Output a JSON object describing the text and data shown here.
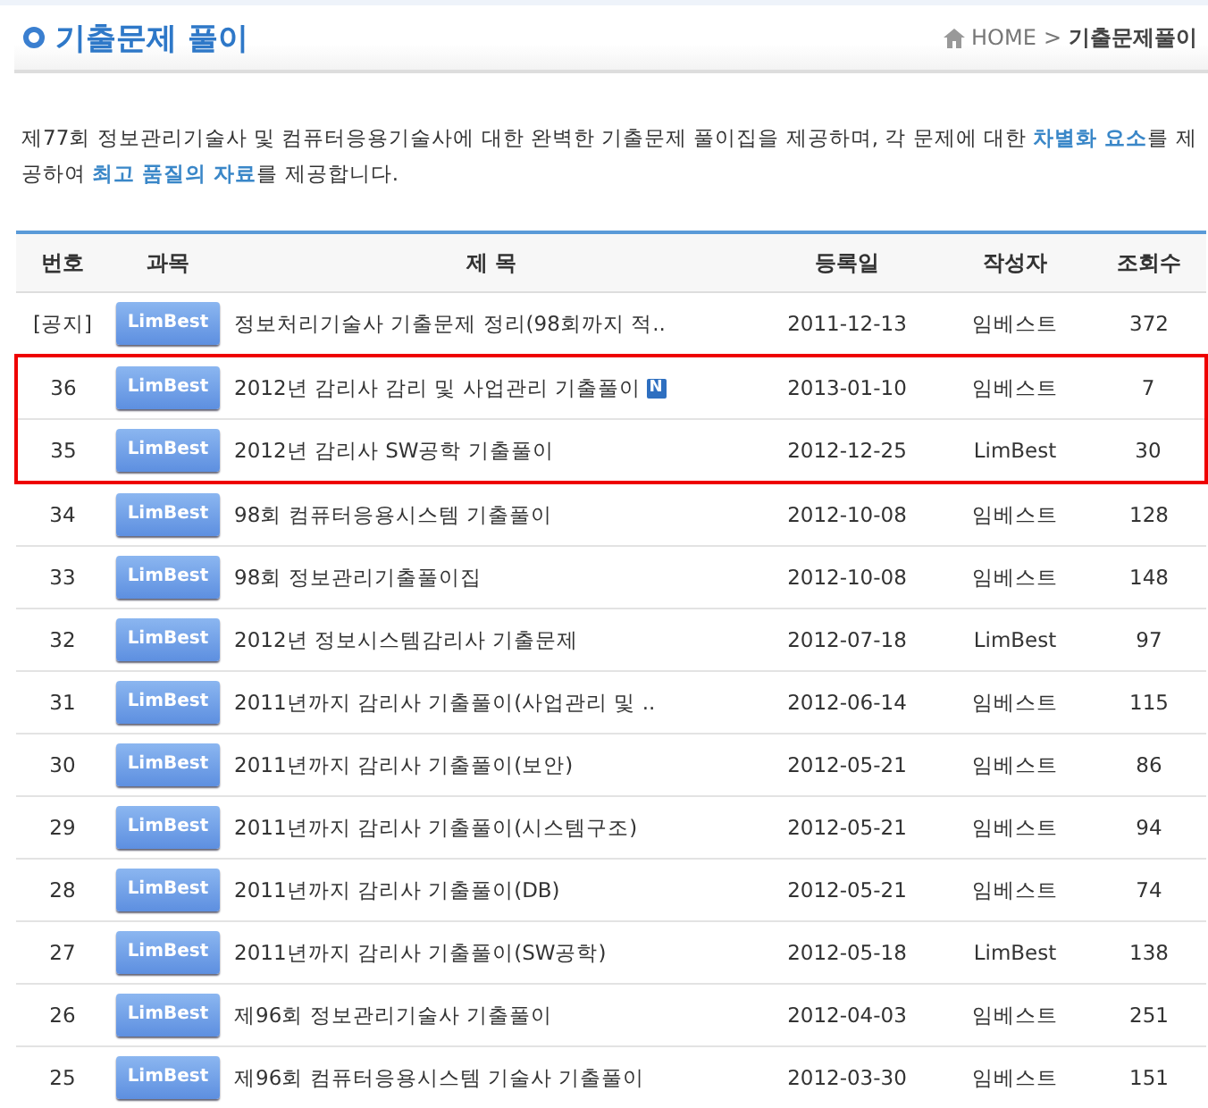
{
  "page_title": "기출문제 풀이",
  "breadcrumb": [
    "HOME",
    "기출문제풀이"
  ],
  "breadcrumb_separator": ">",
  "intro": "제77회 정보관리기술사 및 컴퓨터응용기술사에 대한 완벽한 기출문제 풀이집을 제공하며, 각 문제에 대한 **차별화 요소**를 제공하여 **최고 품질의 자료**를 제공합니다.",
  "table": {
    "columns": [
      "번호",
      "과목",
      "제 목",
      "등록일",
      "작성자",
      "조회수"
    ],
    "rows": [
      {
        "no": "[공지]",
        "subject": "LimBest",
        "title": "정보처리기술사 기출문제 정리(98회까지 적..",
        "new": false,
        "date": "2011-12-13",
        "author": "임베스트",
        "views": "372",
        "highlighted": false
      },
      {
        "no": "36",
        "subject": "LimBest",
        "title": "2012년 감리사 감리 및 사업관리 기출풀이",
        "new": true,
        "new_label": "N",
        "date": "2013-01-10",
        "author": "임베스트",
        "views": "7",
        "highlighted": true
      },
      {
        "no": "35",
        "subject": "LimBest",
        "title": "2012년 감리사 SW공학 기출풀이",
        "new": false,
        "date": "2012-12-25",
        "author": "LimBest",
        "views": "30",
        "highlighted": true
      },
      {
        "no": "34",
        "subject": "LimBest",
        "title": "98회 컴퓨터응용시스템 기출풀이",
        "new": false,
        "date": "2012-10-08",
        "author": "임베스트",
        "views": "128",
        "highlighted": false
      },
      {
        "no": "33",
        "subject": "LimBest",
        "title": "98회 정보관리기출풀이집",
        "new": false,
        "date": "2012-10-08",
        "author": "임베스트",
        "views": "148",
        "highlighted": false
      },
      {
        "no": "32",
        "subject": "LimBest",
        "title": "2012년 정보시스템감리사 기출문제",
        "new": false,
        "date": "2012-07-18",
        "author": "LimBest",
        "views": "97",
        "highlighted": false
      },
      {
        "no": "31",
        "subject": "LimBest",
        "title": "2011년까지 감리사 기출풀이(사업관리 및 ..",
        "new": false,
        "date": "2012-06-14",
        "author": "임베스트",
        "views": "115",
        "highlighted": false
      },
      {
        "no": "30",
        "subject": "LimBest",
        "title": "2011년까지 감리사 기출풀이(보안)",
        "new": false,
        "date": "2012-05-21",
        "author": "임베스트",
        "views": "86",
        "highlighted": false
      },
      {
        "no": "29",
        "subject": "LimBest",
        "title": "2011년까지 감리사 기출풀이(시스템구조)",
        "new": false,
        "date": "2012-05-21",
        "author": "임베스트",
        "views": "94",
        "highlighted": false
      },
      {
        "no": "28",
        "subject": "LimBest",
        "title": "2011년까지 감리사 기출풀이(DB)",
        "new": false,
        "date": "2012-05-21",
        "author": "임베스트",
        "views": "74",
        "highlighted": false
      },
      {
        "no": "27",
        "subject": "LimBest",
        "title": "2011년까지 감리사 기출풀이(SW공학)",
        "new": false,
        "date": "2012-05-18",
        "author": "LimBest",
        "views": "138",
        "highlighted": false
      },
      {
        "no": "26",
        "subject": "LimBest",
        "title": "제96회 정보관리기술사 기출풀이",
        "new": false,
        "date": "2012-04-03",
        "author": "임베스트",
        "views": "251",
        "highlighted": false
      },
      {
        "no": "25",
        "subject": "LimBest",
        "title": "제96회 컴퓨터응용시스템 기술사 기출풀이",
        "new": false,
        "date": "2012-03-30",
        "author": "임베스트",
        "views": "151",
        "highlighted": false
      }
    ]
  }
}
